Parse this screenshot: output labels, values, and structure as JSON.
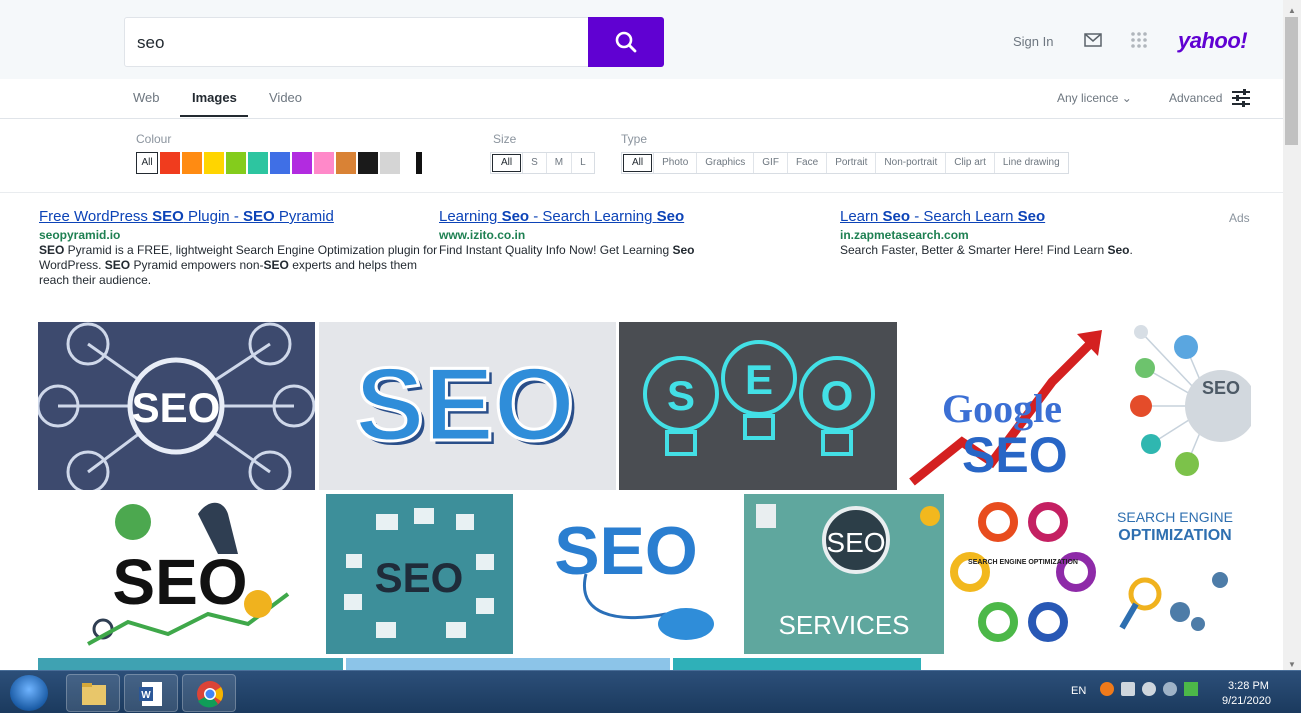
{
  "search": {
    "query": "seo",
    "button_label": "Search"
  },
  "header": {
    "sign_in": "Sign In",
    "logo": "yahoo!",
    "mail_icon": "mail-icon",
    "apps_icon": "apps-grid-icon"
  },
  "tabs": [
    {
      "label": "Web"
    },
    {
      "label": "Images",
      "active": true
    },
    {
      "label": "Video"
    }
  ],
  "toolbar": {
    "licence": "Any licence ⌄",
    "advanced": "Advanced"
  },
  "filters": {
    "colour_label": "Colour",
    "colour_all": "All",
    "colours": [
      "#f03c1e",
      "#ff8b12",
      "#ffd500",
      "#84cc1c",
      "#2dc5a0",
      "#3f6fe6",
      "#b22be0",
      "#ff89c9",
      "#d98235",
      "#1a1a1a",
      "#d5d5d5",
      "#ffffff"
    ],
    "size_label": "Size",
    "sizes": [
      "All",
      "S",
      "M",
      "L"
    ],
    "type_label": "Type",
    "types": [
      "All",
      "Photo",
      "Graphics",
      "GIF",
      "Face",
      "Portrait",
      "Non-portrait",
      "Clip art",
      "Line drawing"
    ]
  },
  "ads": {
    "label": "Ads",
    "items": [
      {
        "title_parts": [
          "Free WordPress ",
          "SEO",
          " Plugin - ",
          "SEO",
          " Pyramid"
        ],
        "url": "seopyramid.io",
        "desc_parts": [
          "SEO",
          " Pyramid is a FREE, lightweight Search Engine Optimization plugin for WordPress. ",
          "SEO",
          " Pyramid empowers non-",
          "SEO",
          " experts and helps them reach their audience."
        ]
      },
      {
        "title_parts": [
          "Learning ",
          "Seo",
          " - Search Learning ",
          "Seo"
        ],
        "url": "www.izito.co.in",
        "desc_parts": [
          "Find Instant Quality Info Now! Get Learning ",
          "Seo"
        ]
      },
      {
        "title_parts": [
          "Learn ",
          "Seo",
          " - Search Learn ",
          "Seo"
        ],
        "url": "in.zapmetasearch.com",
        "desc_parts": [
          "Search Faster, Better & Smarter Here! Find Learn ",
          "Seo",
          "."
        ]
      }
    ]
  },
  "results": [
    {
      "text": "SEO"
    },
    {
      "text": "SEO"
    },
    {
      "text": "SEO"
    },
    {
      "text": "Google",
      "sub": "SEO"
    },
    {
      "text": "SEO"
    },
    {
      "text": "SEO"
    },
    {
      "text": "SEO"
    },
    {
      "text": "SEO"
    },
    {
      "text": "SEO",
      "sub": "SERVICES"
    },
    {
      "text": "SEARCH ENGINE OPTIMIZATION"
    },
    {
      "text": "SEARCH ENGINE",
      "sub": "OPTIMIZATION"
    }
  ],
  "taskbar": {
    "lang": "EN",
    "time": "3:28 PM",
    "date": "9/21/2020"
  }
}
